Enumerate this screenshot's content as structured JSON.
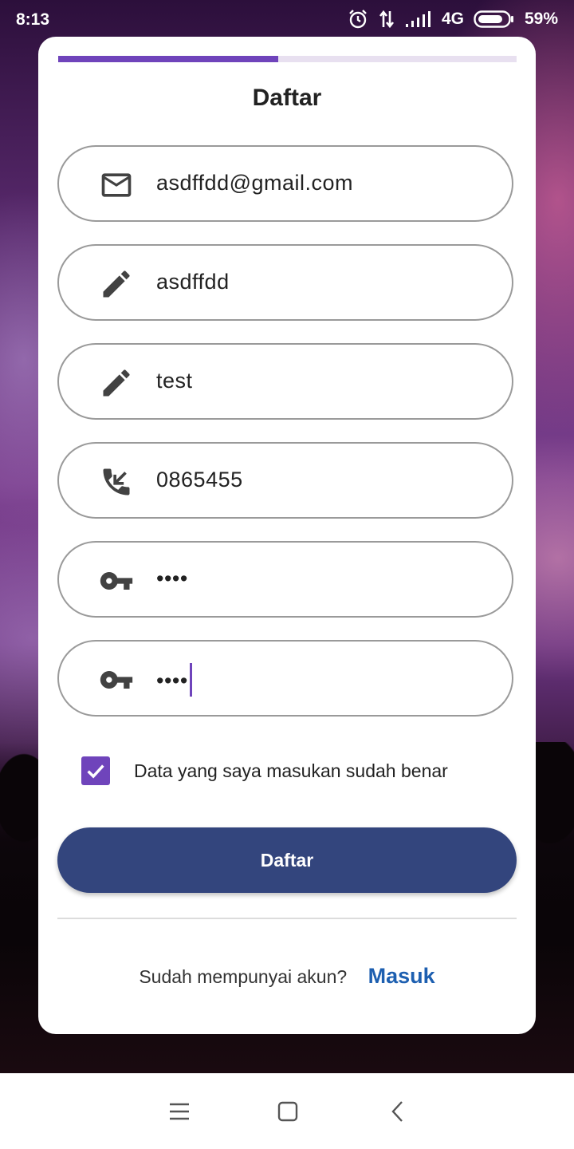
{
  "status_bar": {
    "time": "8:13",
    "network": "4G",
    "battery": "59%",
    "icons": [
      "alarm-icon",
      "data-transfer-icon",
      "signal-icon",
      "battery-icon"
    ]
  },
  "form": {
    "progress": 0.48,
    "title": "Daftar",
    "fields": [
      {
        "icon": "email-icon",
        "value": "asdffdd@gmail.com"
      },
      {
        "icon": "edit-icon",
        "value": "asdffdd"
      },
      {
        "icon": "edit-icon",
        "value": "test"
      },
      {
        "icon": "phone-icon",
        "value": "0865455"
      },
      {
        "icon": "key-icon",
        "value": "••••"
      },
      {
        "icon": "key-icon",
        "value": "••••"
      }
    ],
    "agree_checked": true,
    "agree_label": "Data yang saya masukan sudah benar",
    "submit_label": "Daftar",
    "login_question": "Sudah mempunyai akun?",
    "login_link": "Masuk"
  },
  "colors": {
    "accent": "#6f44bb",
    "button": "#33457d",
    "link": "#1d5fb0"
  },
  "nav_bar": {
    "icons": [
      "menu-icon",
      "home-square-icon",
      "back-icon"
    ]
  }
}
